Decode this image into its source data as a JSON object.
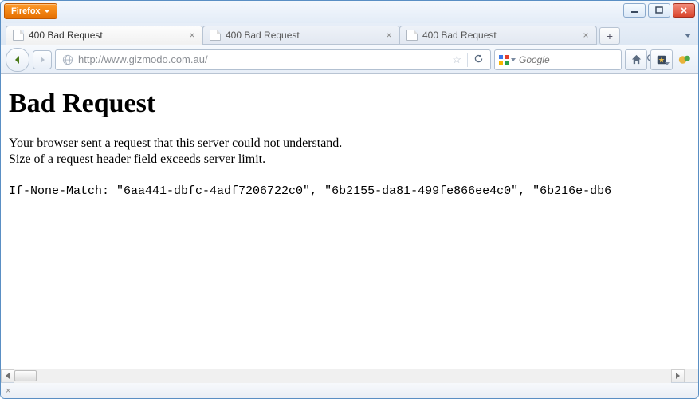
{
  "window": {
    "firefox_label": "Firefox"
  },
  "tabs": [
    {
      "title": "400 Bad Request",
      "active": true
    },
    {
      "title": "400 Bad Request",
      "active": false
    },
    {
      "title": "400 Bad Request",
      "active": false
    }
  ],
  "navbar": {
    "url": "http://www.gizmodo.com.au/",
    "search_placeholder": "Google"
  },
  "page": {
    "heading": "Bad Request",
    "line1": "Your browser sent a request that this server could not understand.",
    "line2": "Size of a request header field exceeds server limit.",
    "header_dump": "If-None-Match: \"6aa441-dbfc-4adf7206722c0\", \"6b2155-da81-499fe866ee4c0\", \"6b216e-db6"
  },
  "statusbar": {
    "left": "×"
  }
}
